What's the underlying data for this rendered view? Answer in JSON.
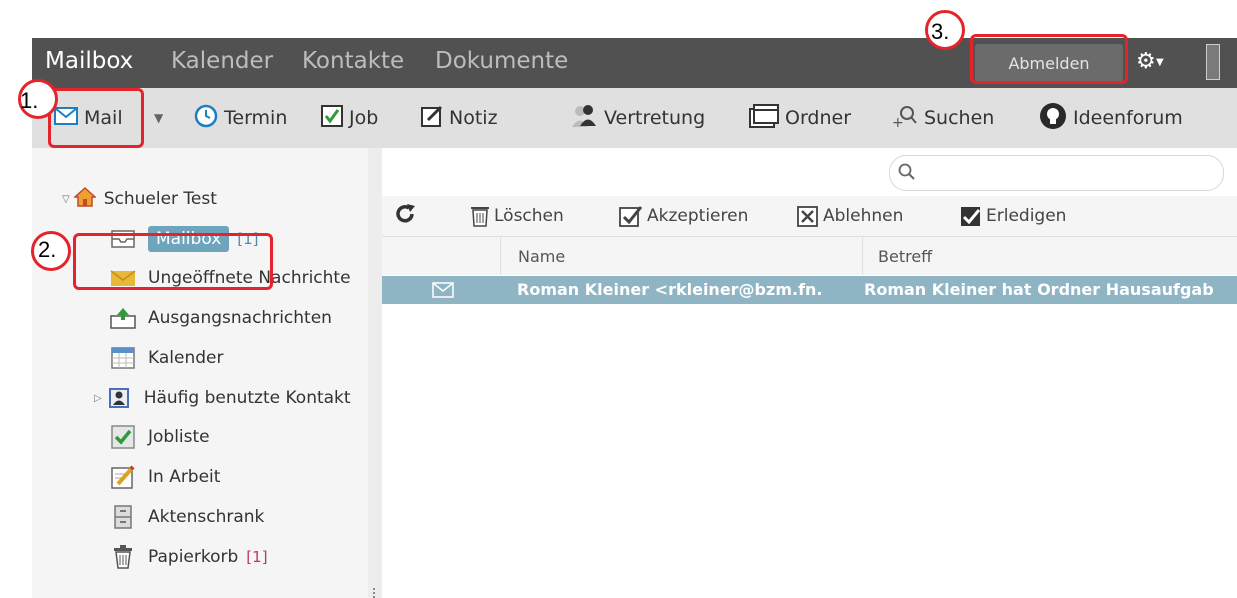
{
  "topnav": {
    "tabs": [
      {
        "label": "Mailbox",
        "active": true
      },
      {
        "label": "Kalender",
        "active": false
      },
      {
        "label": "Kontakte",
        "active": false
      },
      {
        "label": "Dokumente",
        "active": false
      }
    ],
    "logout_label": "Abmelden",
    "settings_icon": "gear-icon"
  },
  "toolbar": {
    "items": [
      {
        "label": "Mail",
        "icon": "envelope-icon"
      },
      {
        "label": "Termin",
        "icon": "clock-icon"
      },
      {
        "label": "Job",
        "icon": "checkbox-icon"
      },
      {
        "label": "Notiz",
        "icon": "note-icon"
      },
      {
        "label": "Vertretung",
        "icon": "person-icon"
      },
      {
        "label": "Ordner",
        "icon": "folder-icon"
      },
      {
        "label": "Suchen",
        "icon": "search-icon"
      },
      {
        "label": "Ideenforum",
        "icon": "lightbulb-icon"
      }
    ]
  },
  "folders": {
    "root": "Schueler Test",
    "items": [
      {
        "label": "Mailbox",
        "count": "[1]",
        "icon": "inbox-icon"
      },
      {
        "label": "Ungeöffnete Nachrichte",
        "icon": "envelope-icon"
      },
      {
        "label": "Ausgangsnachrichten",
        "icon": "outbox-icon"
      },
      {
        "label": "Kalender",
        "icon": "calendar-icon"
      },
      {
        "label": "Häufig benutzte Kontakt",
        "icon": "contacts-icon"
      },
      {
        "label": "Jobliste",
        "icon": "checklist-icon"
      },
      {
        "label": "In Arbeit",
        "icon": "edit-icon"
      },
      {
        "label": "Aktenschrank",
        "icon": "cabinet-icon"
      },
      {
        "label": "Papierkorb",
        "count": "[1]",
        "icon": "trash-icon"
      }
    ]
  },
  "list": {
    "actions": [
      {
        "label": "Löschen",
        "icon": "trash-icon"
      },
      {
        "label": "Akzeptieren",
        "icon": "checkbox-icon"
      },
      {
        "label": "Ablehnen",
        "icon": "x-box-icon"
      },
      {
        "label": "Erledigen",
        "icon": "checkbox-icon"
      }
    ],
    "columns": [
      "Name",
      "Betreff"
    ],
    "rows": [
      {
        "name": "Roman Kleiner <rkleiner@bzm.fn.",
        "subject": "Roman Kleiner hat Ordner Hausaufgab"
      }
    ]
  },
  "annotations": [
    "1.",
    "2.",
    "3."
  ],
  "colors": {
    "annotation": "#e4232a",
    "selection": "#8fb4c4",
    "accent": "#4f8da9"
  }
}
